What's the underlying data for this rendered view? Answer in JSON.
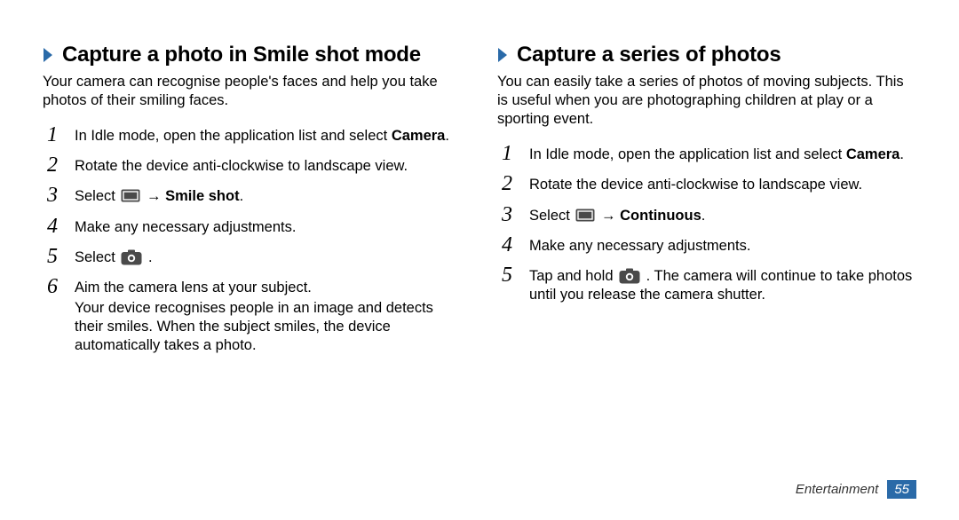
{
  "left": {
    "title": "Capture a photo in Smile shot mode",
    "intro": "Your camera can recognise people's faces and help you take photos of their smiling faces.",
    "steps": [
      {
        "num": "1",
        "parts": [
          {
            "t": "text",
            "v": "In Idle mode, open the application list and select "
          },
          {
            "t": "bold",
            "v": "Camera"
          },
          {
            "t": "text",
            "v": "."
          }
        ]
      },
      {
        "num": "2",
        "parts": [
          {
            "t": "text",
            "v": "Rotate the device anti-clockwise to landscape view."
          }
        ]
      },
      {
        "num": "3",
        "parts": [
          {
            "t": "text",
            "v": "Select "
          },
          {
            "t": "icon-rect"
          },
          {
            "t": "text",
            "v": " → "
          },
          {
            "t": "bold",
            "v": "Smile shot"
          },
          {
            "t": "text",
            "v": "."
          }
        ]
      },
      {
        "num": "4",
        "parts": [
          {
            "t": "text",
            "v": "Make any necessary adjustments."
          }
        ]
      },
      {
        "num": "5",
        "parts": [
          {
            "t": "text",
            "v": "Select "
          },
          {
            "t": "icon-cam"
          },
          {
            "t": "text",
            "v": " ."
          }
        ]
      },
      {
        "num": "6",
        "parts": [
          {
            "t": "text",
            "v": "Aim the camera lens at your subject."
          }
        ],
        "extra": "Your device recognises people in an image and detects their smiles. When the subject smiles, the device automatically takes a photo."
      }
    ]
  },
  "right": {
    "title": "Capture a series of photos",
    "intro": "You can easily take a series of photos of moving subjects. This is useful when you are photographing children at play or a sporting event.",
    "steps": [
      {
        "num": "1",
        "parts": [
          {
            "t": "text",
            "v": "In Idle mode, open the application list and select "
          },
          {
            "t": "bold",
            "v": "Camera"
          },
          {
            "t": "text",
            "v": "."
          }
        ]
      },
      {
        "num": "2",
        "parts": [
          {
            "t": "text",
            "v": "Rotate the device anti-clockwise to landscape view."
          }
        ]
      },
      {
        "num": "3",
        "parts": [
          {
            "t": "text",
            "v": "Select "
          },
          {
            "t": "icon-rect"
          },
          {
            "t": "text",
            "v": " → "
          },
          {
            "t": "bold",
            "v": "Continuous"
          },
          {
            "t": "text",
            "v": "."
          }
        ]
      },
      {
        "num": "4",
        "parts": [
          {
            "t": "text",
            "v": "Make any necessary adjustments."
          }
        ]
      },
      {
        "num": "5",
        "parts": [
          {
            "t": "text",
            "v": "Tap and hold "
          },
          {
            "t": "icon-cam"
          },
          {
            "t": "text",
            "v": " . The camera will continue to take photos until you release the camera shutter."
          }
        ]
      }
    ]
  },
  "footer": {
    "section": "Entertainment",
    "page": "55"
  }
}
